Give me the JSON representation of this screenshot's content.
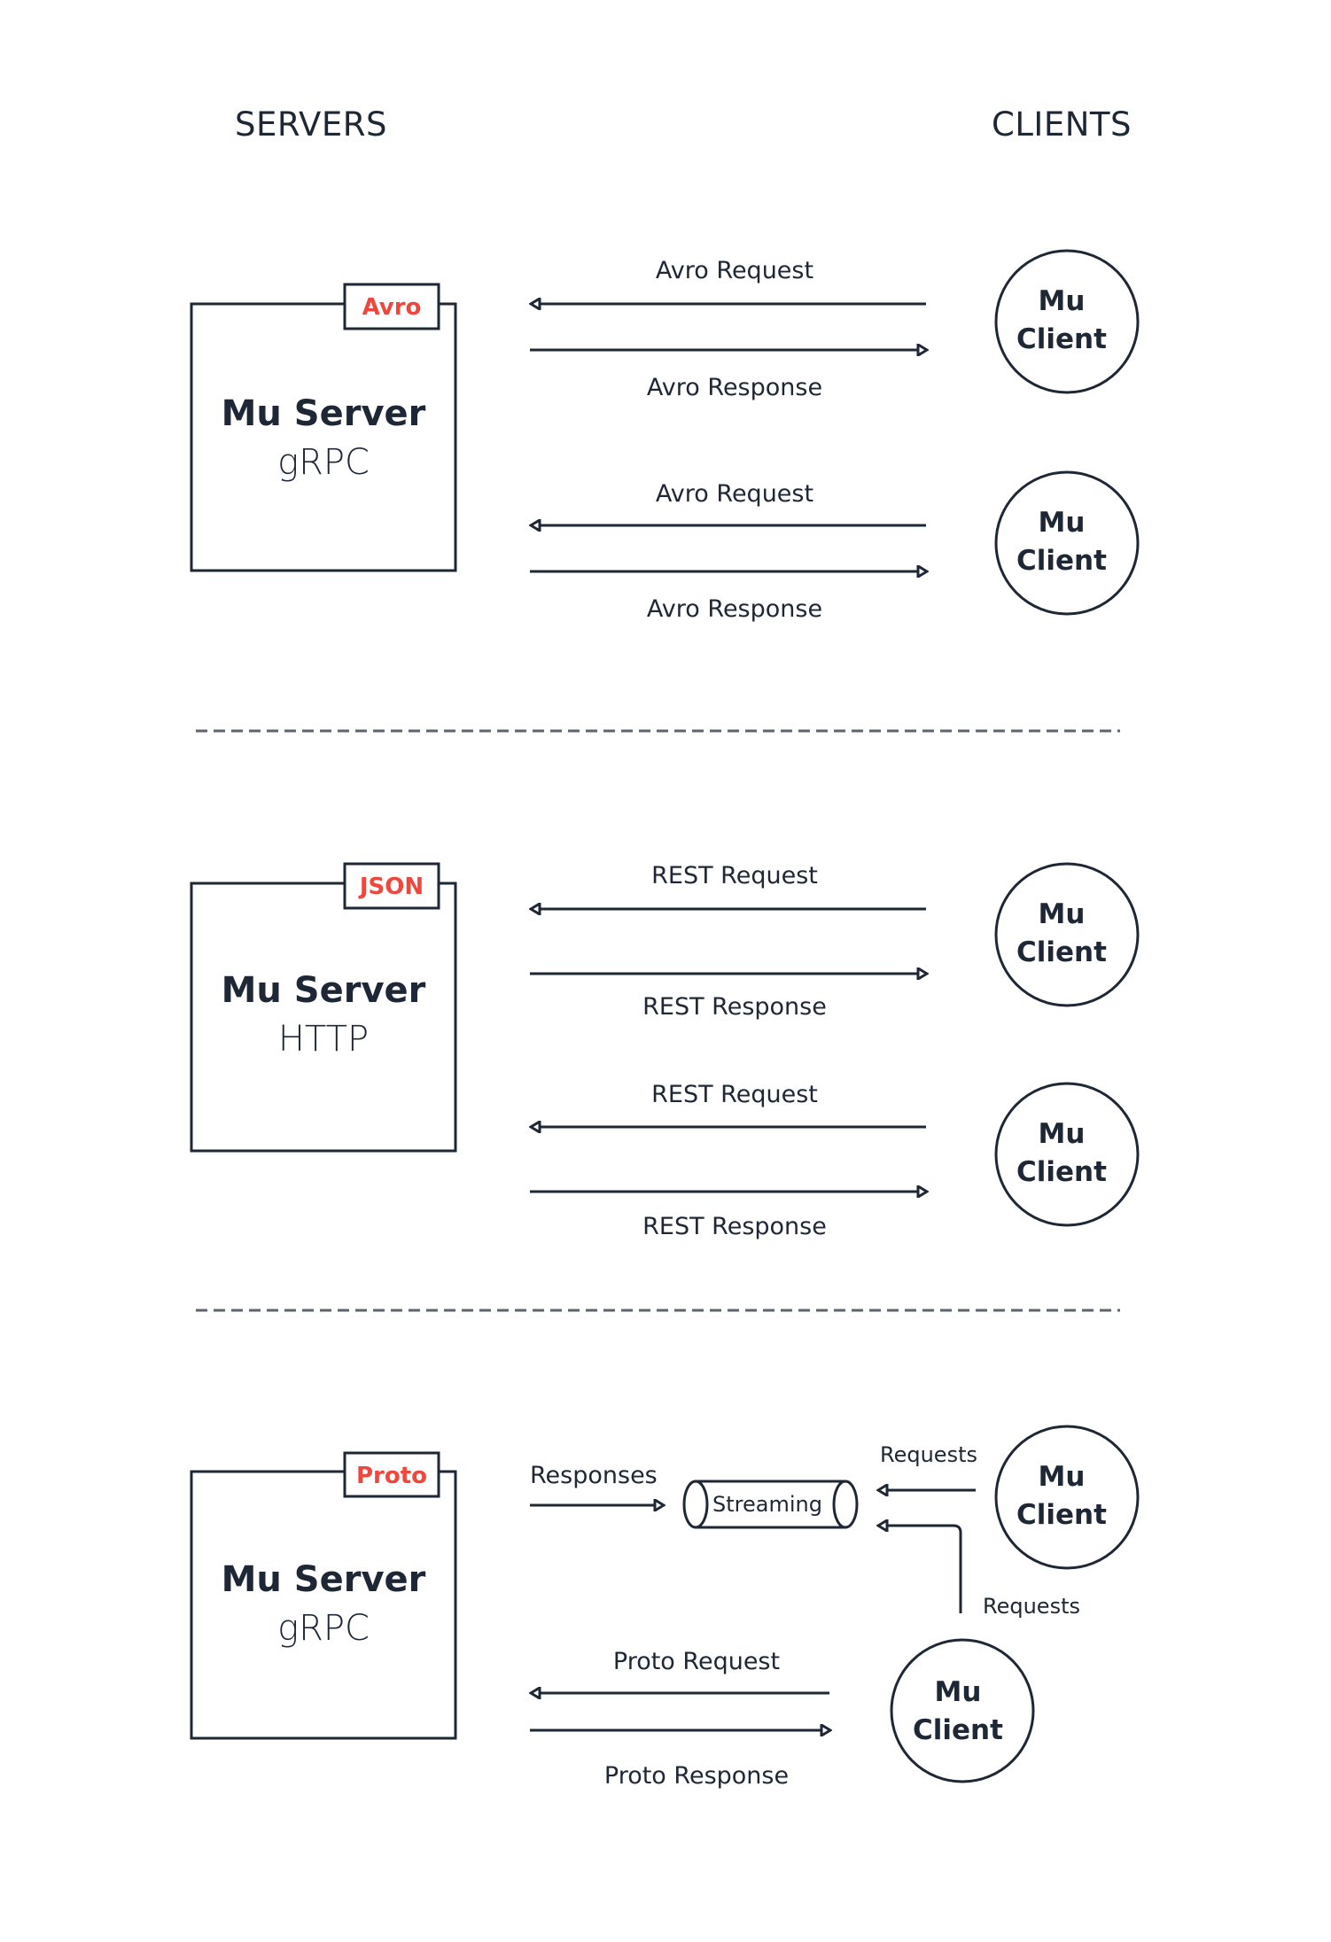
{
  "headers": {
    "servers": "SERVERS",
    "clients": "CLIENTS"
  },
  "colors": {
    "ink": "#1d2736",
    "accent": "#f0463c",
    "divider": "#5d6470"
  },
  "sections": [
    {
      "server": {
        "title": "Mu Server",
        "subtitle": "gRPC",
        "tag": "Avro"
      },
      "links": [
        {
          "request": "Avro Request",
          "response": "Avro Response",
          "client": [
            "Mu",
            "Client"
          ]
        },
        {
          "request": "Avro Request",
          "response": "Avro Response",
          "client": [
            "Mu",
            "Client"
          ]
        }
      ]
    },
    {
      "server": {
        "title": "Mu Server",
        "subtitle": "HTTP",
        "tag": "JSON"
      },
      "links": [
        {
          "request": "REST Request",
          "response": "REST Response",
          "client": [
            "Mu",
            "Client"
          ]
        },
        {
          "request": "REST Request",
          "response": "REST Response",
          "client": [
            "Mu",
            "Client"
          ]
        }
      ]
    },
    {
      "server": {
        "title": "Mu Server",
        "subtitle": "gRPC",
        "tag": "Proto"
      },
      "streaming": {
        "responses_label": "Responses",
        "channel_label": "Streaming",
        "requests_label_top": "Requests",
        "requests_label_bottom": "Requests",
        "client": [
          "Mu",
          "Client"
        ]
      },
      "links": [
        {
          "request": "Proto Request",
          "response": "Proto Response",
          "client": [
            "Mu",
            "Client"
          ]
        }
      ]
    }
  ]
}
